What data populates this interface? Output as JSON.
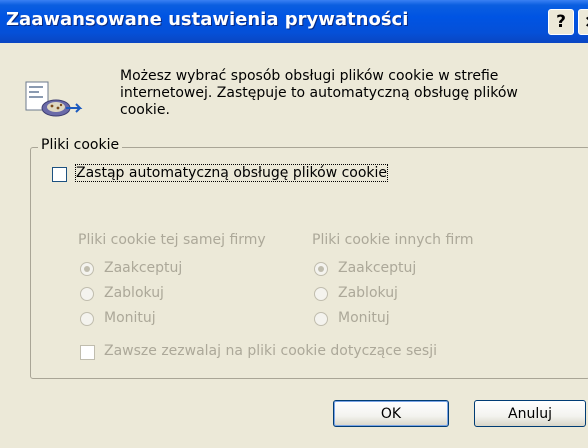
{
  "window": {
    "title": "Zaawansowane ustawienia prywatności",
    "help_label": "?",
    "close_label": "×"
  },
  "info": {
    "text": "Możesz wybrać sposób obsługi plików cookie w strefie internetowej. Zastępuje to automatyczną obsługę plików cookie."
  },
  "group": {
    "legend": "Pliki cookie",
    "override_label": "Zastąp automatyczną obsługę plików cookie",
    "override_checked": false,
    "first_party": {
      "header": "Pliki cookie tej samej firmy",
      "options": [
        "Zaakceptuj",
        "Zablokuj",
        "Monituj"
      ],
      "selected": "Zaakceptuj"
    },
    "third_party": {
      "header": "Pliki cookie innych firm",
      "options": [
        "Zaakceptuj",
        "Zablokuj",
        "Monituj"
      ],
      "selected": "Zaakceptuj"
    },
    "session_label": "Zawsze zezwalaj na pliki cookie dotyczące sesji",
    "session_checked": false
  },
  "buttons": {
    "ok": "OK",
    "cancel": "Anuluj"
  },
  "icons": {
    "info": "cookie-settings-icon",
    "help": "help-icon",
    "close": "close-icon"
  },
  "colors": {
    "titlebar": "#0054e3",
    "dialog_bg": "#ece9d8",
    "disabled_text": "#aca899"
  }
}
